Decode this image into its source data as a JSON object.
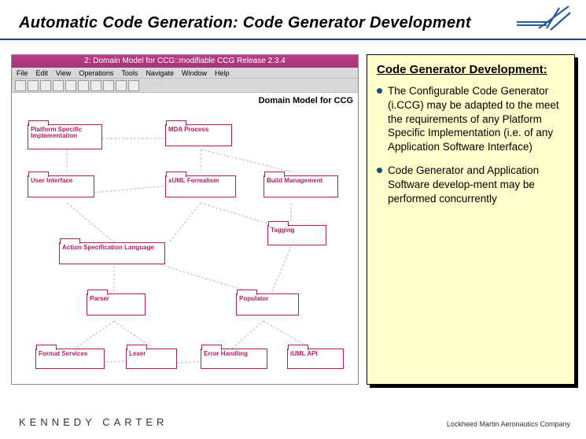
{
  "header": {
    "title": "Automatic Code Generation: Code Generator Development"
  },
  "app": {
    "title": "2: Domain Model for CCG::modifiable CCG Release 2.3.4",
    "menu": {
      "file": "File",
      "edit": "Edit",
      "view": "View",
      "operations": "Operations",
      "tools": "Tools",
      "navigate": "Navigate",
      "window": "Window",
      "help": "Help"
    },
    "canvas_title": "Domain Model for CCG",
    "packages": {
      "psi": "Platform Specific\nImplementation",
      "mda": "MDA Process",
      "ui": "User Interface",
      "xuml": "xUML Formalism",
      "build": "Build Management",
      "asl": "Action Specification Language",
      "tagging": "Tagging",
      "parser": "Parser",
      "populator": "Populator",
      "format": "Format Services",
      "lexer": "Lexer",
      "error": "Error Handling",
      "api": "iUML API"
    }
  },
  "info": {
    "title": "Code Generator Development:",
    "bullets": [
      "The Configurable Code Generator (i.CCG) may be adapted to the meet the requirements of any Platform Specific Implementation (i.e. of any Application Software Interface)",
      "Code Generator and Application Software develop-ment may be performed concurrently"
    ]
  },
  "footer": {
    "left": "KENNEDY  CARTER",
    "right": "Lockheed Martin Aeronautics Company"
  }
}
